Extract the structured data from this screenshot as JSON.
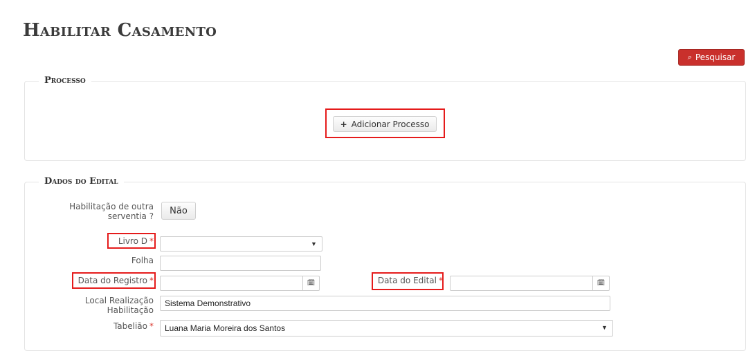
{
  "page": {
    "title": "Habilitar Casamento"
  },
  "toolbar": {
    "search_label": "Pesquisar",
    "search_icon": "search-icon"
  },
  "processo": {
    "legend": "Processo",
    "add_label": "Adicionar Processo",
    "add_icon": "plus-icon"
  },
  "edital": {
    "legend": "Dados do Edital",
    "habilitacao": {
      "label": "Habilitação de outra serventia ?",
      "toggle_value": "Não"
    },
    "livro_d": {
      "label": "Livro D",
      "required_mark": "*",
      "value": ""
    },
    "folha": {
      "label": "Folha",
      "value": ""
    },
    "data_registro": {
      "label": "Data do Registro",
      "required_mark": "*",
      "value": ""
    },
    "data_edital": {
      "label": "Data do Edital",
      "required_mark": "*",
      "value": ""
    },
    "local": {
      "label": "Local Realização Habilitação",
      "value": "Sistema Demonstrativo"
    },
    "tabeliao": {
      "label": "Tabelião",
      "required_mark": "*",
      "value": "Luana Maria Moreira dos Santos"
    }
  },
  "colors": {
    "accent": "#c9302c",
    "highlight": "#e51b1b",
    "required": "#d9342b"
  }
}
